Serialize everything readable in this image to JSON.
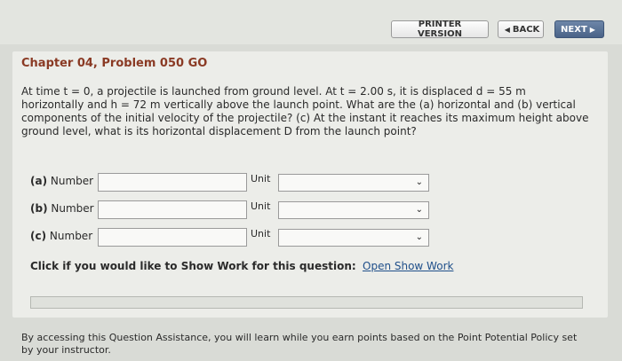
{
  "toolbar": {
    "printer_label": "PRINTER VERSION",
    "back_label": "BACK",
    "next_label": "NEXT"
  },
  "problem": {
    "title": "Chapter 04, Problem 050 GO",
    "text": "At time t = 0, a projectile is launched from ground level. At t = 2.00 s, it is displaced d = 55 m horizontally and h = 72 m vertically above the launch point. What are the (a) horizontal and (b) vertical components of the initial velocity of the projectile? (c) At the instant it reaches its maximum height above ground level, what is its horizontal displacement D from the launch point?"
  },
  "answers": [
    {
      "part": "(a)",
      "label": "Number",
      "value": "",
      "unit_label": "Unit",
      "unit_value": ""
    },
    {
      "part": "(b)",
      "label": "Number",
      "value": "",
      "unit_label": "Unit",
      "unit_value": ""
    },
    {
      "part": "(c)",
      "label": "Number",
      "value": "",
      "unit_label": "Unit",
      "unit_value": ""
    }
  ],
  "show_work": {
    "prompt": "Click if you would like to Show Work for this question:",
    "link": "Open Show Work"
  },
  "footer": {
    "text": "By accessing this Question Assistance, you will learn while you earn points based on the Point Potential Policy set by your instructor."
  },
  "icons": {
    "back": "triangle-left-icon",
    "next": "triangle-right-icon",
    "dropdown": "chevron-down-icon"
  },
  "colors": {
    "title": "#8a3a24",
    "link": "#1f4f8a",
    "next_button": "#4a6388",
    "background": "#d9dbd6"
  }
}
